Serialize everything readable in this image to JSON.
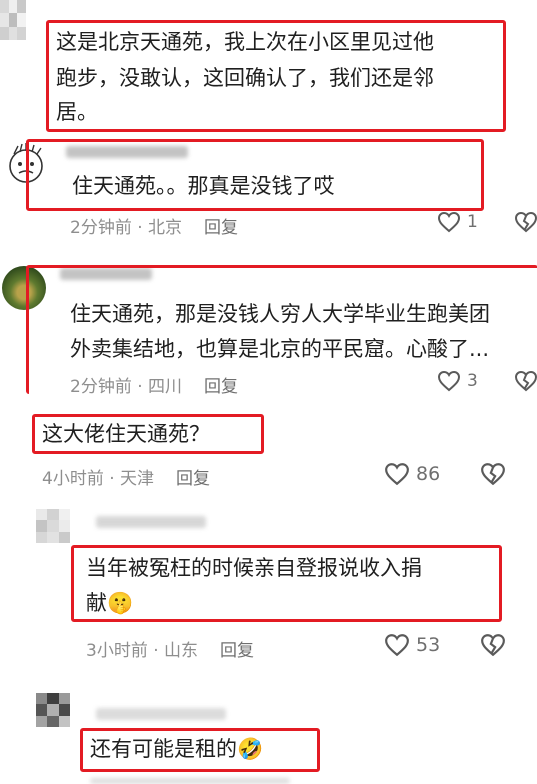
{
  "comments": [
    {
      "text_lines": [
        "这是北京天通苑，我上次在小区里见过他",
        "跑步，没敢认，这回确认了，我们还是邻",
        "居。"
      ]
    },
    {
      "text": "住天通苑。。那真是没钱了哎",
      "time": "2分钟前",
      "location": "北京",
      "reply": "回复",
      "likes": "1"
    },
    {
      "text_lines": [
        "住天通苑，那是没钱人穷人大学毕业生跑美团",
        "外卖集结地，也算是北京的平民窟。心酸了..."
      ],
      "time": "2分钟前",
      "location": "四川",
      "reply": "回复",
      "likes": "3"
    },
    {
      "text": "这大佬住天通苑？",
      "time": "4小时前",
      "location": "天津",
      "reply": "回复",
      "likes": "86"
    },
    {
      "text_lines": [
        "当年被冤枉的时候亲自登报说收入捐",
        "献"
      ],
      "emoji": "🤫",
      "time": "3小时前",
      "location": "山东",
      "reply": "回复",
      "likes": "53"
    },
    {
      "text": "还有可能是租的",
      "emoji": "🤣"
    }
  ],
  "meta_separator": " · ",
  "colors": {
    "highlight": "#e31b23",
    "meta": "#8e8e8e",
    "text": "#1f1f1f"
  },
  "icons": {
    "like": "heart-outline",
    "dislike": "broken-heart-outline"
  }
}
